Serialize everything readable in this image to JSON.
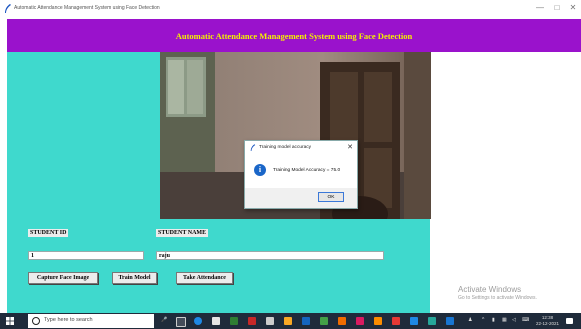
{
  "window": {
    "title": "Automatic Attendance Management System using Face Detection",
    "controls": [
      "—",
      "□",
      "✕"
    ]
  },
  "header": {
    "title": "Automatic Attendance Management System using Face Detection"
  },
  "form": {
    "student_id_label": "STUDENT ID",
    "student_id_value": "1",
    "student_name_label": "STUDENT NAME",
    "student_name_value": "raju"
  },
  "buttons": {
    "capture": "Capture Face Image",
    "train": "Train Model",
    "attendance": "Take Attendance"
  },
  "dialog": {
    "title": "Training model accuracy",
    "message": "Training Model Accuracy = 75.0",
    "ok": "OK"
  },
  "watermark": {
    "line1": "Activate Windows",
    "line2": "Go to Settings to activate Windows."
  },
  "taskbar": {
    "search_placeholder": "Type here to search",
    "time": "12:38",
    "date": "22-12-2021"
  },
  "colors": {
    "header_bg": "#9a12cc",
    "header_text": "#f4f000",
    "form_bg": "#3fd9cd"
  }
}
